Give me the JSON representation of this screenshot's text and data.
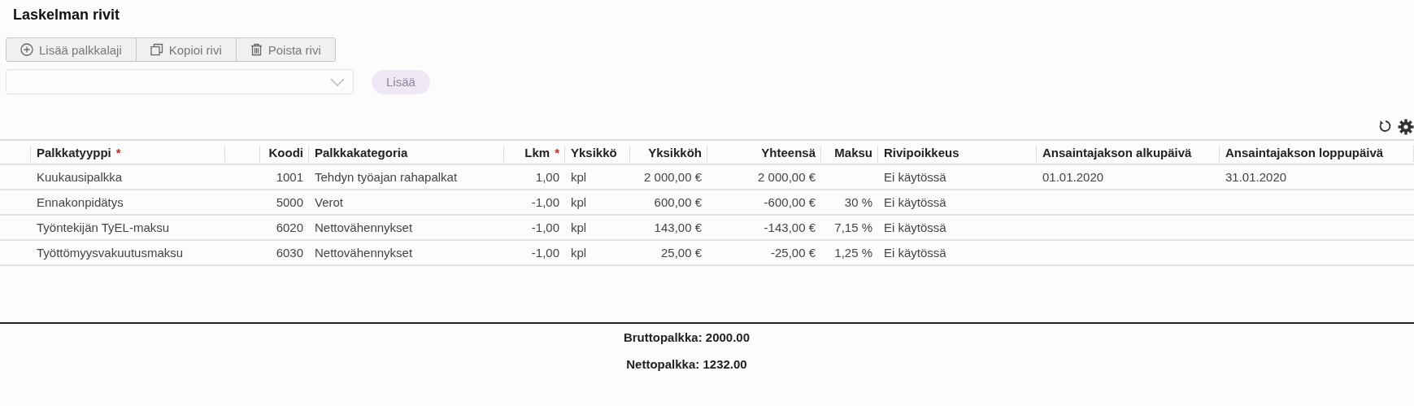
{
  "title": "Laskelman rivit",
  "toolbar": [
    {
      "kind": "add",
      "label": "Lisää palkkalaji"
    },
    {
      "kind": "copy",
      "label": "Kopioi rivi"
    },
    {
      "kind": "delete",
      "label": "Poista rivi"
    }
  ],
  "add_form": {
    "button": "Lisää",
    "disabled": true
  },
  "table": {
    "columns": [
      {},
      {
        "label": "Palkkatyyppi",
        "required_mark": "*"
      },
      {},
      {
        "label": "Koodi"
      },
      {
        "label": "Palkkakategoria"
      },
      {
        "label": "Lkm",
        "required_mark": "*"
      },
      {
        "label": "Yksikkö"
      },
      {
        "label": "Yksikköh"
      },
      {
        "label": "Yhteensä"
      },
      {
        "label": "Maksu"
      },
      {
        "label": "Rivipoikkeus"
      },
      {
        "label": "Ansaintajakson alkupäivä"
      },
      {
        "label": "Ansaintajakson loppupäivä"
      }
    ],
    "rows": [
      [
        null,
        "Kuukausipalkka",
        null,
        "1001",
        "Tehdyn työajan rahapalkat",
        "1,00",
        "kpl",
        "2 000,00 €",
        "2 000,00 €",
        null,
        "Ei käytössä",
        "01.01.2020",
        "31.01.2020"
      ],
      [
        null,
        "Ennakonpidätys",
        null,
        "5000",
        "Verot",
        "-1,00",
        "kpl",
        "600,00 €",
        "-600,00 €",
        "30 %",
        "Ei käytössä",
        null,
        null
      ],
      [
        null,
        "Työntekijän TyEL-maksu",
        null,
        "6020",
        "Nettovähennykset",
        "-1,00",
        "kpl",
        "143,00 €",
        "-143,00 €",
        "7,15 %",
        "Ei käytössä",
        null,
        null
      ],
      [
        null,
        "Työttömyysvakuutusmaksu",
        null,
        "6030",
        "Nettovähennykset",
        "-1,00",
        "kpl",
        "25,00 €",
        "-25,00 €",
        "1,25 %",
        "Ei käytössä",
        null,
        null
      ]
    ]
  },
  "totals": [
    "Bruttopalkka: 2000.00",
    "Nettopalkka: 1232.00"
  ]
}
